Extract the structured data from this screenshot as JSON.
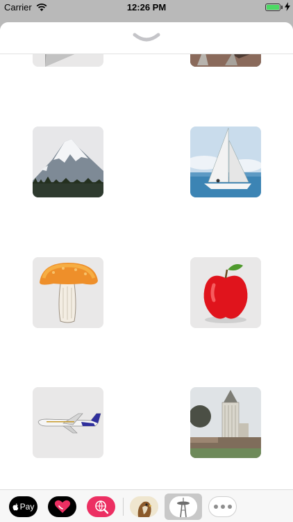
{
  "status_bar": {
    "carrier": "Carrier",
    "time": "12:26 PM",
    "battery_level": 1.0,
    "battery_color": "#4cd964",
    "signal_icon": "wifi-icon",
    "charging_icon": "charging-bolt-icon"
  },
  "sheet": {
    "collapse_icon": "chevron-down-icon"
  },
  "stickers": [
    {
      "name": "paper-plane"
    },
    {
      "name": "rusty-metal"
    },
    {
      "name": "mount-rainier"
    },
    {
      "name": "sailboat"
    },
    {
      "name": "mushroom"
    },
    {
      "name": "red-apple"
    },
    {
      "name": "airplane"
    },
    {
      "name": "smith-tower"
    }
  ],
  "drawer": {
    "apple_pay_label": "Pay",
    "apps": [
      "apple-pay",
      "heart-sticker-app",
      "web-search-app",
      "hawk-sticker-app",
      "space-needle-sticker-app",
      "more-apps"
    ],
    "colors": {
      "heart_app": "#000000",
      "search_app": "#ec2f62",
      "selected_bg": "#c8c8c8"
    }
  }
}
